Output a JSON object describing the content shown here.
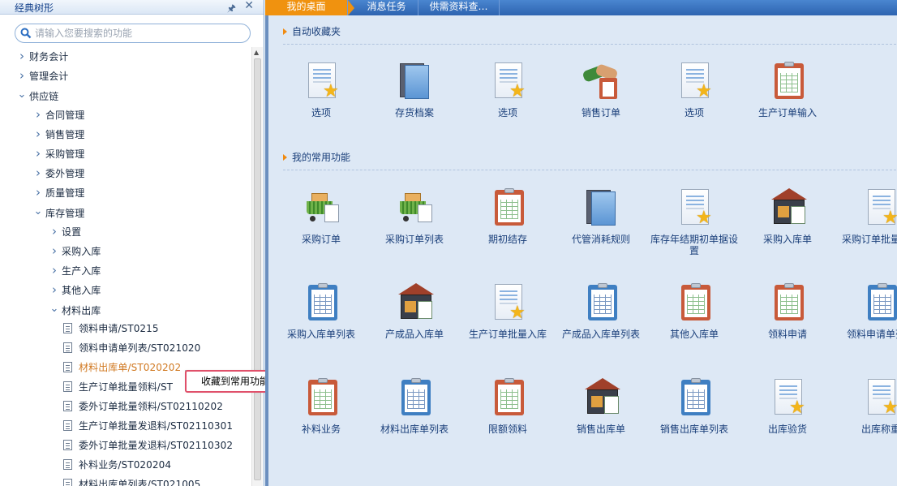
{
  "sidebar": {
    "title": "经典树形",
    "pin_icon": "pin-icon",
    "close_icon": "close-icon",
    "search_placeholder": "请输入您要搜索的功能",
    "tree": [
      {
        "label": "财务会计",
        "level": 0,
        "expanded": false
      },
      {
        "label": "管理会计",
        "level": 0,
        "expanded": false
      },
      {
        "label": "供应链",
        "level": 0,
        "expanded": true
      },
      {
        "label": "合同管理",
        "level": 1,
        "expanded": false
      },
      {
        "label": "销售管理",
        "level": 1,
        "expanded": false
      },
      {
        "label": "采购管理",
        "level": 1,
        "expanded": false
      },
      {
        "label": "委外管理",
        "level": 1,
        "expanded": false
      },
      {
        "label": "质量管理",
        "level": 1,
        "expanded": false
      },
      {
        "label": "库存管理",
        "level": 1,
        "expanded": true
      },
      {
        "label": "设置",
        "level": 2,
        "expanded": false
      },
      {
        "label": "采购入库",
        "level": 2,
        "expanded": false
      },
      {
        "label": "生产入库",
        "level": 2,
        "expanded": false
      },
      {
        "label": "其他入库",
        "level": 2,
        "expanded": false
      },
      {
        "label": "材料出库",
        "level": 2,
        "expanded": true
      },
      {
        "label": "领料申请/ST0215",
        "level": 3,
        "leaf": true
      },
      {
        "label": "领料申请单列表/ST021020",
        "level": 3,
        "leaf": true
      },
      {
        "label": "材料出库单/ST020202",
        "level": 3,
        "leaf": true,
        "active": true
      },
      {
        "label": "生产订单批量领料/ST",
        "level": 3,
        "leaf": true
      },
      {
        "label": "委外订单批量领料/ST02110202",
        "level": 3,
        "leaf": true
      },
      {
        "label": "生产订单批量发退料/ST02110301",
        "level": 3,
        "leaf": true
      },
      {
        "label": "委外订单批量发退料/ST02110302",
        "level": 3,
        "leaf": true
      },
      {
        "label": "补料业务/ST020204",
        "level": 3,
        "leaf": true
      },
      {
        "label": "材料出库单列表/ST021005",
        "level": 3,
        "leaf": true
      }
    ],
    "context_menu": {
      "item": "收藏到常用功能"
    }
  },
  "tabs": [
    "我的桌面",
    "消息任务",
    "供需资料查…"
  ],
  "sections": {
    "favorites": {
      "title": "自动收藏夹",
      "items": [
        {
          "label": "选项",
          "icon": "doc-star-icon"
        },
        {
          "label": "存货档案",
          "icon": "books-icon"
        },
        {
          "label": "选项",
          "icon": "doc-star-icon"
        },
        {
          "label": "销售订单",
          "icon": "handshake-icon"
        },
        {
          "label": "选项",
          "icon": "doc-star-icon"
        },
        {
          "label": "生产订单输入",
          "icon": "clipboard-red-icon"
        }
      ]
    },
    "common": {
      "title": "我的常用功能",
      "rows": [
        [
          {
            "label": "采购订单",
            "icon": "cart-icon"
          },
          {
            "label": "采购订单列表",
            "icon": "cart-check-icon"
          },
          {
            "label": "期初结存",
            "icon": "clipboard-red-icon"
          },
          {
            "label": "代管消耗规则",
            "icon": "books-icon"
          },
          {
            "label": "库存年结期初单据设置",
            "icon": "doc-star-icon"
          },
          {
            "label": "采购入库单",
            "icon": "warehouse-icon"
          },
          {
            "label": "采购订单批量入库",
            "icon": "doc-star-icon"
          }
        ],
        [
          {
            "label": "采购入库单列表",
            "icon": "clipboard-blue-icon"
          },
          {
            "label": "产成品入库单",
            "icon": "warehouse-icon"
          },
          {
            "label": "生产订单批量入库",
            "icon": "doc-star-icon"
          },
          {
            "label": "产成品入库单列表",
            "icon": "clipboard-blue-icon"
          },
          {
            "label": "其他入库单",
            "icon": "clipboard-red-icon"
          },
          {
            "label": "领料申请",
            "icon": "clipboard-red-icon"
          },
          {
            "label": "领料申请单列表",
            "icon": "clipboard-blue-icon"
          }
        ],
        [
          {
            "label": "补料业务",
            "icon": "clipboard-red-icon"
          },
          {
            "label": "材料出库单列表",
            "icon": "clipboard-blue-icon"
          },
          {
            "label": "限额领料",
            "icon": "clipboard-red-icon"
          },
          {
            "label": "销售出库单",
            "icon": "warehouse-out-icon"
          },
          {
            "label": "销售出库单列表",
            "icon": "clipboard-blue-icon"
          },
          {
            "label": "出库验货",
            "icon": "doc-star-icon"
          },
          {
            "label": "出库称重",
            "icon": "doc-star-icon"
          }
        ]
      ]
    }
  }
}
